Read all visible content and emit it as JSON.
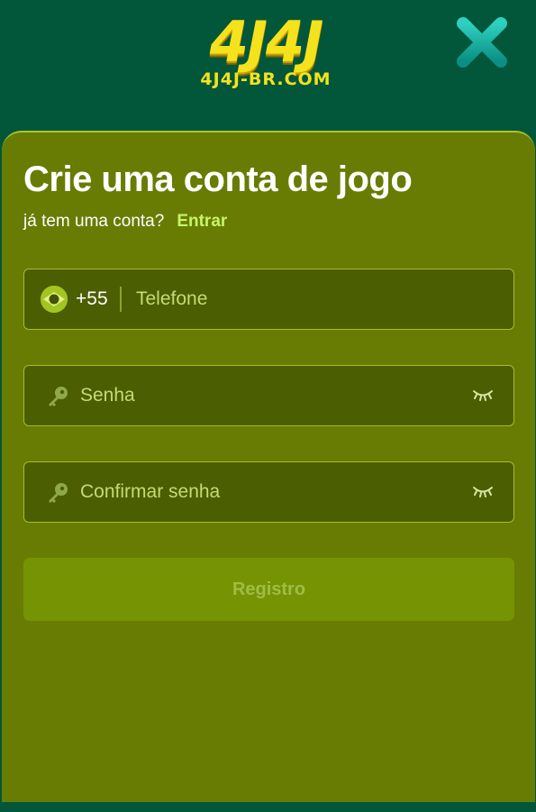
{
  "header": {
    "logo_main": "4J4J",
    "logo_sub": "4J4J-BR.COM",
    "close_icon": "close-icon"
  },
  "form": {
    "title": "Crie uma conta de jogo",
    "subtitle": "já tem uma conta?",
    "login_link": "Entrar",
    "phone": {
      "country_icon": "brazil-flag-icon",
      "country_code": "+55",
      "placeholder": "Telefone"
    },
    "password": {
      "icon": "key-icon",
      "placeholder": "Senha",
      "toggle_icon": "eye-closed-icon"
    },
    "confirm_password": {
      "icon": "key-icon",
      "placeholder": "Confirmar senha",
      "toggle_icon": "eye-closed-icon"
    },
    "register_label": "Registro"
  },
  "colors": {
    "header_bg": "#02573a",
    "panel_bg": "#687c03",
    "field_bg": "#4b5e02",
    "accent_link": "#c6f46a",
    "logo_yellow": "#f4e21c"
  }
}
